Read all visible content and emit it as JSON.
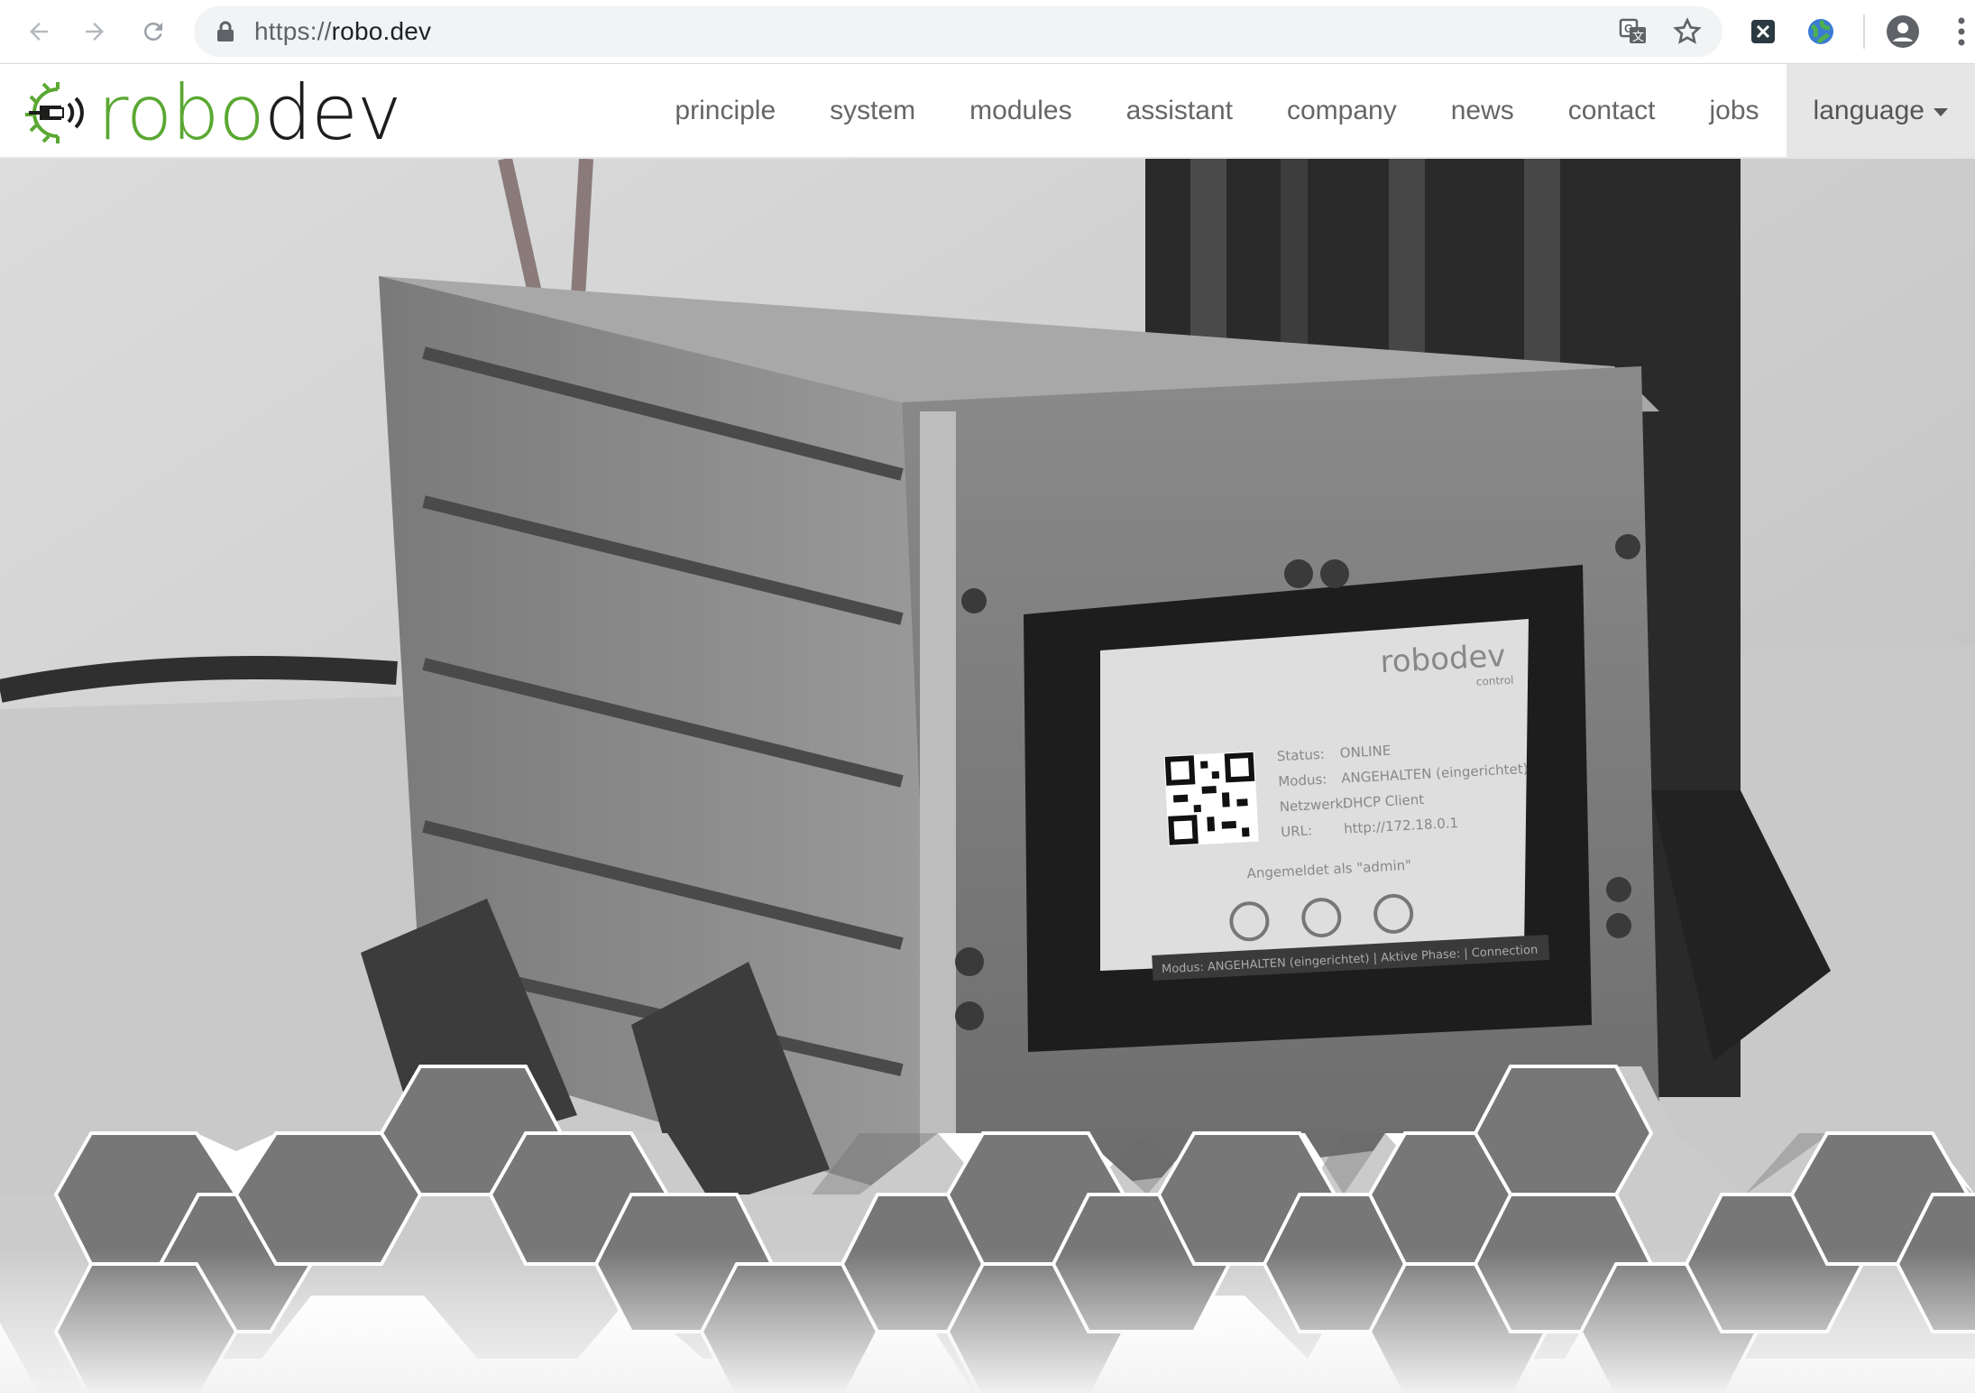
{
  "browser": {
    "url_scheme": "https://",
    "url_host": "robo.dev",
    "back_icon": "arrow-left-icon",
    "forward_icon": "arrow-right-icon",
    "reload_icon": "reload-icon",
    "secure_icon": "lock-icon",
    "translate_icon": "translate-icon",
    "bookmark_icon": "star-icon",
    "extensions": [
      "x-extension-icon",
      "globe-extension-icon"
    ],
    "profile_icon": "account-icon",
    "menu_icon": "kebab-menu-icon"
  },
  "site": {
    "logo": {
      "text_green": "robo",
      "text_dark": "dev",
      "icon": "robot-gear-icon"
    },
    "nav": [
      {
        "label": "principle"
      },
      {
        "label": "system"
      },
      {
        "label": "modules"
      },
      {
        "label": "assistant"
      },
      {
        "label": "company"
      },
      {
        "label": "news"
      },
      {
        "label": "contact"
      },
      {
        "label": "jobs"
      }
    ],
    "language_label": "language",
    "colors": {
      "brand_green": "#5aa832",
      "brand_dark": "#1d1d1b",
      "nav_text": "#666666"
    }
  },
  "hero": {
    "device_screen": {
      "brand": "robodev",
      "brand_sub": "control",
      "rows": [
        {
          "label": "Status:",
          "value": "ONLINE"
        },
        {
          "label": "Modus:",
          "value": "ANGEHALTEN (eingerichtet)"
        },
        {
          "label": "Netzwerk:",
          "value": "DHCP Client"
        },
        {
          "label": "URL:",
          "value": "http://172.18.0.1"
        }
      ],
      "logged_in": "Angemeldet als \"admin\"",
      "footer": "Modus: ANGEHALTEN (eingerichtet) | Aktive Phase: | Connection"
    }
  }
}
